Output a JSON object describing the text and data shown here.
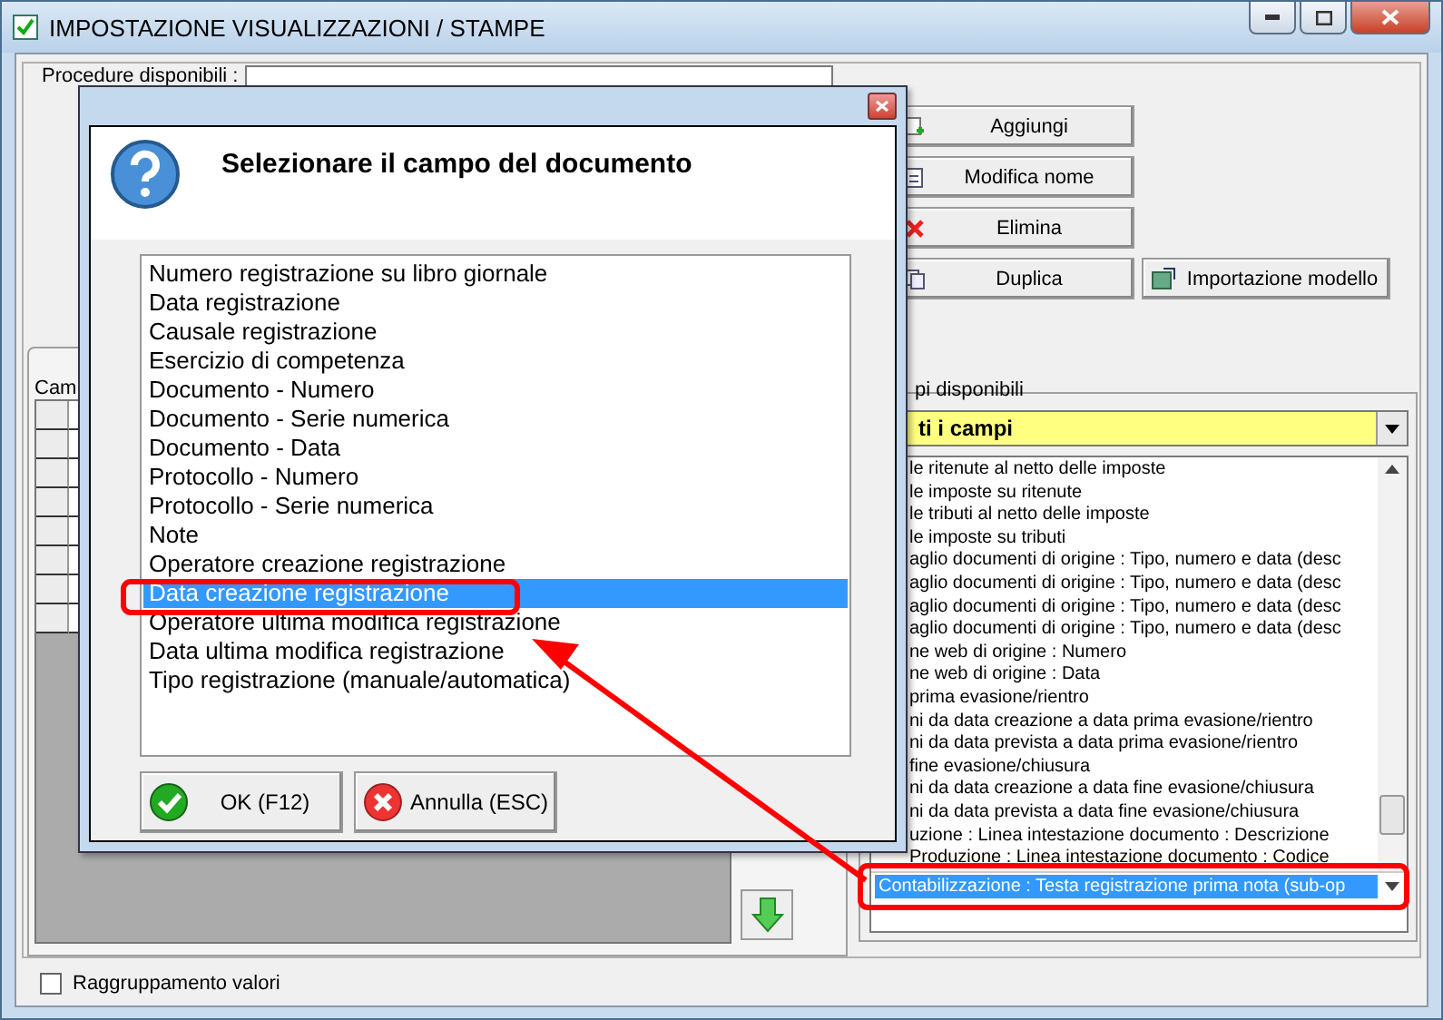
{
  "window": {
    "title": "IMPOSTAZIONE VISUALIZZAZIONI / STAMPE"
  },
  "procedure": {
    "label": "Procedure disponibili :"
  },
  "actions": [
    {
      "label": "Aggiungi",
      "kind": "add"
    },
    {
      "label": "Modifica nome",
      "kind": "rename"
    },
    {
      "label": "Elimina",
      "kind": "delete"
    },
    {
      "label": "Duplica",
      "kind": "copy"
    }
  ],
  "import_button": {
    "label": "Importazione modello"
  },
  "fields_panel": {
    "label": "Cam"
  },
  "available": {
    "legend": "pi disponibili",
    "filter": "ti i campi",
    "items": [
      "le ritenute al netto delle imposte",
      "le imposte su ritenute",
      "le tributi al netto delle imposte",
      "le imposte su tributi",
      "aglio documenti di origine : Tipo, numero e data (desc",
      "aglio documenti di origine : Tipo, numero e data (desc",
      "aglio documenti di origine : Tipo, numero e data (desc",
      "aglio documenti di origine : Tipo, numero e data (desc",
      "ne web di origine : Numero",
      "ne web di origine : Data",
      "prima evasione/rientro",
      "ni da data creazione a data prima evasione/rientro",
      "ni da data prevista a data prima evasione/rientro",
      "fine evasione/chiusura",
      "ni da data creazione a data fine evasione/chiusura",
      "ni da data prevista a data fine evasione/chiusura",
      "uzione : Linea intestazione documento : Descrizione",
      "Produzione : Linea intestazione documento : Codice"
    ],
    "selected_field": "Contabilizzazione : Testa registrazione prima nota (sub-op"
  },
  "grouping": {
    "label": "Raggruppamento valori",
    "checked": false
  },
  "dialog": {
    "title": "Selezionare il campo del documento",
    "items": [
      {
        "label": "Numero registrazione su libro giornale",
        "selected": false
      },
      {
        "label": "Data registrazione",
        "selected": false
      },
      {
        "label": "Causale registrazione",
        "selected": false
      },
      {
        "label": "Esercizio di competenza",
        "selected": false
      },
      {
        "label": "Documento - Numero",
        "selected": false
      },
      {
        "label": "Documento - Serie numerica",
        "selected": false
      },
      {
        "label": "Documento - Data",
        "selected": false
      },
      {
        "label": "Protocollo - Numero",
        "selected": false
      },
      {
        "label": "Protocollo - Serie numerica",
        "selected": false
      },
      {
        "label": "Note",
        "selected": false
      },
      {
        "label": "Operatore creazione registrazione",
        "selected": false
      },
      {
        "label": "Data creazione registrazione",
        "selected": true
      },
      {
        "label": "Operatore ultima modifica registrazione",
        "selected": false
      },
      {
        "label": "Data ultima modifica registrazione",
        "selected": false
      },
      {
        "label": "Tipo registrazione (manuale/automatica)",
        "selected": false
      }
    ],
    "buttons": [
      {
        "label": "OK (F12)",
        "kind": "ok"
      },
      {
        "label": "Annulla (ESC)",
        "kind": "cancel"
      }
    ]
  }
}
